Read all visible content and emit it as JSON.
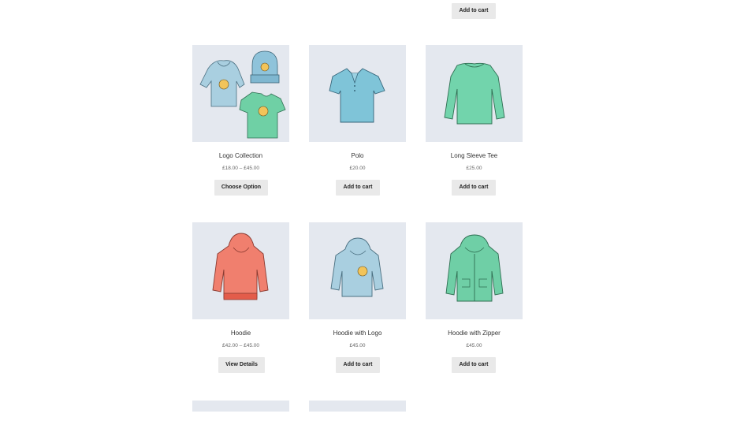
{
  "top_row": {
    "button_label": "Add to cart"
  },
  "products": [
    {
      "name": "Logo Collection",
      "price": "£18.00 – £45.00",
      "button": "Choose Option",
      "image": "logo-collection-image"
    },
    {
      "name": "Polo",
      "price": "£20.00",
      "button": "Add to cart",
      "image": "polo-shirt-image"
    },
    {
      "name": "Long Sleeve Tee",
      "price": "£25.00",
      "button": "Add to cart",
      "image": "long-sleeve-tee-image"
    },
    {
      "name": "Hoodie",
      "price": "£42.00 – £45.00",
      "button": "View Details",
      "image": "hoodie-image"
    },
    {
      "name": "Hoodie with Logo",
      "price": "£45.00",
      "button": "Add to cart",
      "image": "hoodie-with-logo-image"
    },
    {
      "name": "Hoodie with Zipper",
      "price": "£45.00",
      "button": "Add to cart",
      "image": "hoodie-with-zipper-image"
    }
  ],
  "colors": {
    "image_bg": "#e4e8ef",
    "button_bg": "#e9e9e9",
    "hoodie_blue": "#a9cfe0",
    "beanie_blue": "#8fc3da",
    "tshirt_green": "#6fd0a5",
    "polo_blue": "#7fc4d8",
    "sleeve_green": "#72d4ac",
    "hoodie_red": "#f07f6e",
    "zip_green": "#6fcfa6",
    "logo_gold": "#f2c45a"
  }
}
